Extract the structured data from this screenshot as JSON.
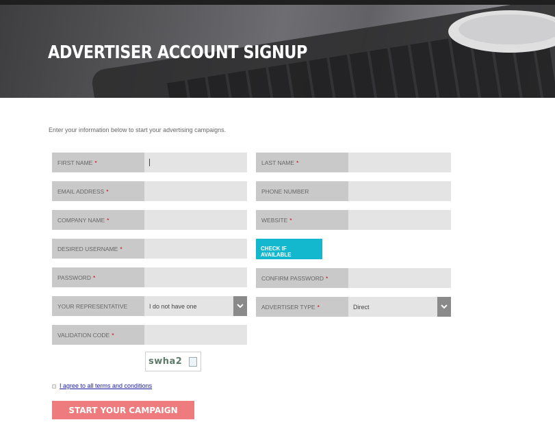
{
  "header": {
    "title": "ADVERTISER ACCOUNT SIGNUP"
  },
  "intro": "Enter your information below to start your advertising campaigns.",
  "required_mark": "*",
  "fields": {
    "first_name": {
      "label": "FIRST NAME",
      "value": ""
    },
    "last_name": {
      "label": "LAST NAME",
      "value": ""
    },
    "email": {
      "label": "EMAIL ADDRESS",
      "value": ""
    },
    "phone": {
      "label": "PHONE NUMBER",
      "value": ""
    },
    "company": {
      "label": "COMPANY NAME",
      "value": ""
    },
    "website": {
      "label": "WEBSITE",
      "value": ""
    },
    "username": {
      "label": "DESIRED USERNAME",
      "value": ""
    },
    "password": {
      "label": "PASSWORD",
      "value": ""
    },
    "confirm_password": {
      "label": "CONFIRM PASSWORD",
      "value": ""
    },
    "representative": {
      "label": "YOUR REPRESENTATIVE",
      "selected": "I do not have one"
    },
    "advertiser_type": {
      "label": "ADVERTISER TYPE",
      "selected": "Direct"
    },
    "validation_code": {
      "label": "VALIDATION CODE",
      "value": ""
    }
  },
  "check_button": "CHECK IF\nAVAILABLE",
  "captcha": {
    "text": "swha2",
    "icon": "refresh-icon"
  },
  "terms": {
    "label": "I agree to all terms and conditions",
    "checked": false
  },
  "submit": "START YOUR CAMPAIGN",
  "colors": {
    "accent_cyan": "#13b8cf",
    "submit_pink": "#ee7b7e",
    "label_bg": "#c9c9c9",
    "input_bg": "#e4e4e4",
    "required_red": "#d0021b"
  }
}
